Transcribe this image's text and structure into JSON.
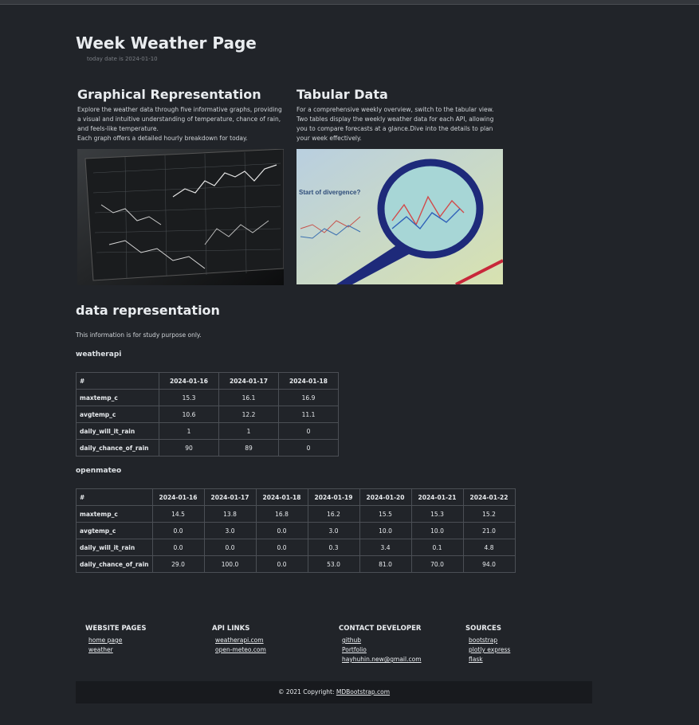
{
  "header": {
    "title": "Week Weather Page",
    "date_text": "today date is 2024-01-10"
  },
  "features": [
    {
      "title": "Graphical Representation",
      "lines": [
        "Explore the weather data through five informative graphs, providing a visual and intuitive understanding of temperature, chance of rain, and feels-like temperature.",
        "Each graph offers a detailed hourly breakdown for today."
      ]
    },
    {
      "title": "Tabular Data",
      "lines": [
        "For a comprehensive weekly overview, switch to the tabular view.",
        "Two tables display the weekly weather data for each API, allowing you to compare forecasts at a glance.Dive into the details to plan your week effectively."
      ]
    }
  ],
  "image2_text": "Start of divergence?",
  "section": {
    "title": "data representation",
    "note": "This information is for study purpose only."
  },
  "tables": [
    {
      "title": "weatherapi",
      "columns": [
        "#",
        "2024-01-16",
        "2024-01-17",
        "2024-01-18"
      ],
      "rows": [
        [
          "maxtemp_c",
          "15.3",
          "16.1",
          "16.9"
        ],
        [
          "avgtemp_c",
          "10.6",
          "12.2",
          "11.1"
        ],
        [
          "daily_will_it_rain",
          "1",
          "1",
          "0"
        ],
        [
          "daily_chance_of_rain",
          "90",
          "89",
          "0"
        ]
      ]
    },
    {
      "title": "openmateo",
      "columns": [
        "#",
        "2024-01-16",
        "2024-01-17",
        "2024-01-18",
        "2024-01-19",
        "2024-01-20",
        "2024-01-21",
        "2024-01-22"
      ],
      "rows": [
        [
          "maxtemp_c",
          "14.5",
          "13.8",
          "16.8",
          "16.2",
          "15.5",
          "15.3",
          "15.2"
        ],
        [
          "avgtemp_c",
          "0.0",
          "3.0",
          "0.0",
          "3.0",
          "10.0",
          "10.0",
          "21.0"
        ],
        [
          "daily_will_it_rain",
          "0.0",
          "0.0",
          "0.0",
          "0.3",
          "3.4",
          "0.1",
          "4.8"
        ],
        [
          "daily_chance_of_rain",
          "29.0",
          "100.0",
          "0.0",
          "53.0",
          "81.0",
          "70.0",
          "94.0"
        ]
      ]
    }
  ],
  "footer": {
    "columns": [
      {
        "title": "WEBSITE PAGES",
        "links": [
          "home page",
          "weather"
        ]
      },
      {
        "title": "API LINKS",
        "links": [
          "weatherapi.com",
          "open-meteo.com"
        ]
      },
      {
        "title": "CONTACT DEVELOPER",
        "links": [
          "github",
          "Portfolio",
          "hayhuhin.new@gmail.com"
        ]
      },
      {
        "title": "SOURCES",
        "links": [
          "bootstrap",
          "plotly express",
          "flask"
        ]
      }
    ],
    "copyright_prefix": "© 2021 Copyright:",
    "copyright_link": "MDBootstrap.com"
  }
}
